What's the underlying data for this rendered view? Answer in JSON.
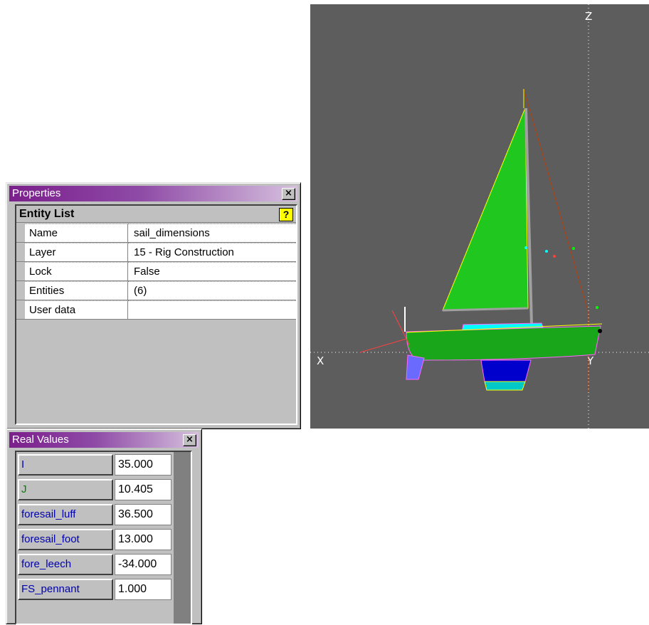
{
  "properties_window": {
    "title": "Properties",
    "close_glyph": "×",
    "section_title": "Entity List",
    "help_glyph": "?",
    "rows": [
      {
        "name": "Name",
        "value": "sail_dimensions"
      },
      {
        "name": "Layer",
        "value": "15 - Rig Construction"
      },
      {
        "name": "Lock",
        "value": "False"
      },
      {
        "name": "Entities",
        "value": "(6)"
      },
      {
        "name": "User data",
        "value": ""
      }
    ]
  },
  "real_values_window": {
    "title": "Real Values",
    "close_glyph": "×",
    "rows": [
      {
        "name": "I",
        "value": "35.000",
        "name_color": "#0000b4"
      },
      {
        "name": "J",
        "value": "10.405",
        "name_color": "#008000"
      },
      {
        "name": "foresail_luff",
        "value": "36.500",
        "name_color": "#0000b4"
      },
      {
        "name": "foresail_foot",
        "value": "13.000",
        "name_color": "#0000b4"
      },
      {
        "name": "fore_leech",
        "value": "-34.000",
        "name_color": "#0000b4"
      },
      {
        "name": "FS_pennant",
        "value": "1.000",
        "name_color": "#0000b4"
      }
    ]
  },
  "viewport": {
    "axis_labels": {
      "x": "X",
      "y": "Y",
      "z": "Z"
    },
    "colors": {
      "background": "#5d5d5d",
      "sail": "#1fc71f",
      "hull": "#1aa61a",
      "deck": "#00ffff",
      "keel": "#0000cc",
      "bulb": "#00c8c8",
      "rudder": "#6a6aff",
      "mast": "#a0a0a0"
    }
  }
}
